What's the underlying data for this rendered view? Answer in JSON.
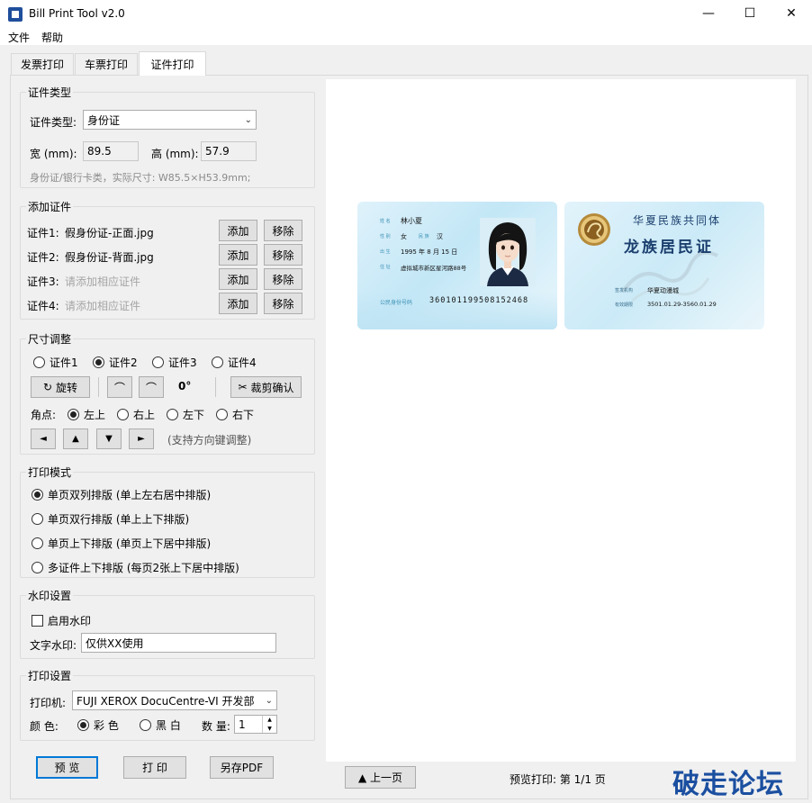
{
  "window": {
    "title": "Bill Print Tool v2.0",
    "minimize": "—",
    "maximize": "☐",
    "close": "✕"
  },
  "menu": [
    "文件",
    "帮助"
  ],
  "tabs": [
    "发票打印",
    "车票打印",
    "证件打印"
  ],
  "cert_type": {
    "group": "证件类型",
    "type_label": "证件类型:",
    "type_value": "身份证",
    "width_label": "宽 (mm):",
    "width_value": "89.5",
    "height_label": "高 (mm):",
    "height_value": "57.9",
    "hint": "身份证/银行卡类，实际尺寸: W85.5×H53.9mm;"
  },
  "add_cert": {
    "group": "添加证件",
    "rows": [
      {
        "label": "证件1:",
        "file": "假身份证-正面.jpg",
        "empty": false
      },
      {
        "label": "证件2:",
        "file": "假身份证-背面.jpg",
        "empty": false
      },
      {
        "label": "证件3:",
        "file": "请添加相应证件",
        "empty": true
      },
      {
        "label": "证件4:",
        "file": "请添加相应证件",
        "empty": true
      }
    ],
    "add_label": "添加",
    "remove_label": "移除"
  },
  "size_adjust": {
    "group": "尺寸调整",
    "certs": [
      "证件1",
      "证件2",
      "证件3",
      "证件4"
    ],
    "selected_cert": 1,
    "rotate_label": "旋转",
    "rotate_glyph": "↻",
    "rot_left_glyph": "⌒",
    "rot_right_glyph": "⌒",
    "angle": "0°",
    "crop_label": "裁剪确认",
    "crop_glyph": "✂",
    "corner_label": "角点:",
    "corners": [
      "左上",
      "右上",
      "左下",
      "右下"
    ],
    "selected_corner": 0,
    "arrows": [
      "◄",
      "▲",
      "▼",
      "►"
    ],
    "arrow_hint": "(支持方向键调整)"
  },
  "print_mode": {
    "group": "打印模式",
    "options": [
      "单页双列排版 (单上左右居中排版)",
      "单页双行排版 (单上上下排版)",
      "单页上下排版 (单页上下居中排版)",
      "多证件上下排版 (每页2张上下居中排版)"
    ],
    "selected": 0
  },
  "watermark": {
    "group": "水印设置",
    "enable_label": "启用水印",
    "enabled": false,
    "text_label": "文字水印:",
    "text_value": "仅供XX使用"
  },
  "print_settings": {
    "group": "打印设置",
    "printer_label": "打印机:",
    "printer_value": "FUJI XEROX DocuCentre-VI 开发部",
    "color_label": "颜  色:",
    "color_option": "彩 色",
    "mono_option": "黑 白",
    "color_selected": "color",
    "qty_label": "数 量:",
    "qty_value": "1",
    "spin_up": "▲",
    "spin_down": "▼"
  },
  "actions": {
    "preview": "预 览",
    "print": "打 印",
    "save_pdf": "另存PDF"
  },
  "preview_footer": {
    "prev": "▲ 上一页",
    "status": "预览打印: 第 1/1 页"
  },
  "id_front": {
    "name_label": "姓 名",
    "name": "林小夏",
    "sex_label": "性 别",
    "sex": "女",
    "ethnic_label": "民 族",
    "ethnic": "汉",
    "birth_label": "出 生",
    "birth": "1995 年  8 月 15 日",
    "addr_label": "住 址",
    "addr": "虚拟城市新区星河路88号",
    "id_label": "公民身份号码",
    "id_number": "360101199508152468"
  },
  "id_back": {
    "line1": "华夏民族共同体",
    "line2": "龙族居民证",
    "authority_label": "签发机构",
    "authority": "华夏动漫城",
    "valid_label": "有效期限",
    "valid": "3501.01.29-3560.01.29"
  },
  "site_watermark": "破走论坛"
}
